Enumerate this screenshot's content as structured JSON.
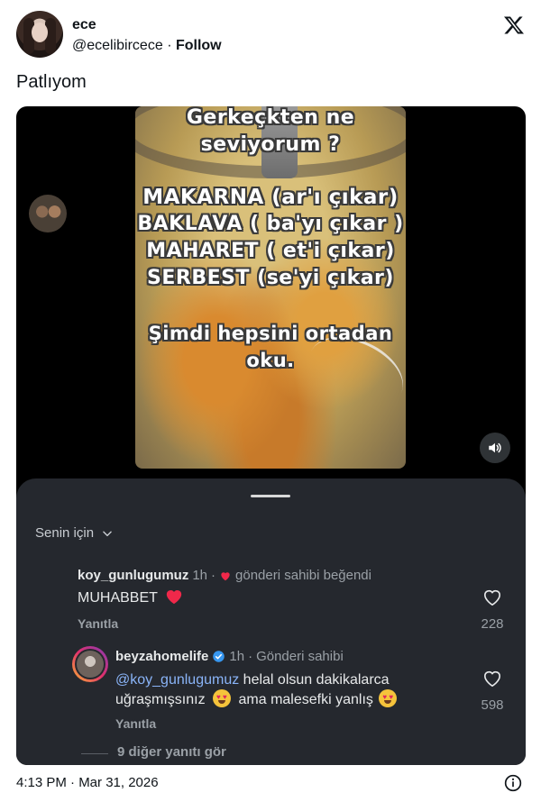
{
  "author": {
    "display_name": "ece",
    "handle": "@ecelibircece",
    "separator": "·",
    "follow_label": "Follow"
  },
  "tweet": {
    "text": "Patlıyom"
  },
  "video": {
    "lines": [
      "Gerkeçkten ne",
      "seviyorum ?",
      "MAKARNA (ar'ı çıkar)",
      "BAKLAVA ( ba'yı çıkar )",
      "MAHARET ( et'i çıkar)",
      "SERBEST (se'yi çıkar)",
      "Şimdi hepsini ortadan",
      "oku."
    ]
  },
  "comments_sheet": {
    "section_label": "Senin için",
    "comments": [
      {
        "user": "koy_gunlugumuz",
        "time": "1h",
        "badge": "gönderi sahibi beğendi",
        "text": "MUHABBET",
        "reply_label": "Yanıtla",
        "likes": "228"
      },
      {
        "user": "beyzahomelife",
        "time": "1h",
        "badge": "Gönderi sahibi",
        "mention": "@koy_gunlugumuz",
        "text_line1": " helal olsun dakikalarca",
        "text_line2": "uğraşmışsınız",
        "text_line2b": "ama malesefki yanlış",
        "reply_label": "Yanıtla",
        "likes": "598"
      }
    ],
    "more_replies": "9 diğer yanıtı gör"
  },
  "footer": {
    "timestamp": "4:13 PM · Mar 31, 2026"
  },
  "colors": {
    "heart": "#f0284a",
    "verified": "#3797f0",
    "sheet_bg": "#25282e"
  }
}
